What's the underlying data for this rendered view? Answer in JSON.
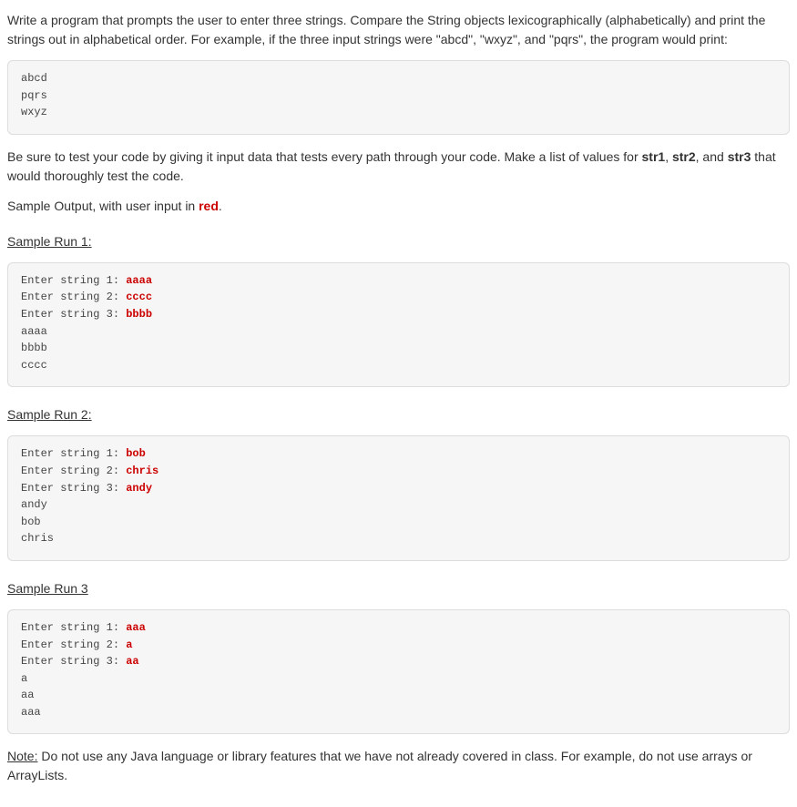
{
  "intro": {
    "p1": "Write a program that prompts the user to enter three strings. Compare the String objects lexicographically (alphabetically) and print the strings out in alphabetical order. For example, if the three input strings were \"abcd\", \"wxyz\", and \"pqrs\", the program would print:"
  },
  "example_box": "abcd\npqrs\nwxyz",
  "test_note_pre": "Be sure to test your code by giving it input data that tests every path through your code. Make a list of values for ",
  "test_note_bold1": "str1",
  "test_note_mid1": ", ",
  "test_note_bold2": "str2",
  "test_note_mid2": ", and ",
  "test_note_bold3": "str3",
  "test_note_post": " that would thoroughly test the code.",
  "sample_output_pre": "Sample Output, with user input in ",
  "sample_output_red": "red",
  "sample_output_post": ".",
  "runs": {
    "r1": {
      "title": "Sample Run 1:  ",
      "l1p": "Enter string 1: ",
      "l1i": "aaaa",
      "l2p": "Enter string 2: ",
      "l2i": "cccc",
      "l3p": "Enter string 3: ",
      "l3i": "bbbb",
      "out": "aaaa\nbbbb\ncccc"
    },
    "r2": {
      "title": "Sample Run 2:",
      "l1p": "Enter string 1: ",
      "l1i": "bob",
      "l2p": "Enter string 2: ",
      "l2i": "chris",
      "l3p": "Enter string 3: ",
      "l3i": "andy",
      "out": "andy\nbob\nchris"
    },
    "r3": {
      "title": "Sample  Run 3",
      "l1p": "Enter string 1: ",
      "l1i": "aaa",
      "l2p": "Enter string 2: ",
      "l2i": "a",
      "l3p": "Enter string 3: ",
      "l3i": "aa",
      "out": "a\naa\naaa"
    }
  },
  "note_label": "Note:",
  "note_text": " Do not use any Java language or library features that we have not already covered in class. For example, do not use arrays or ArrayLists."
}
